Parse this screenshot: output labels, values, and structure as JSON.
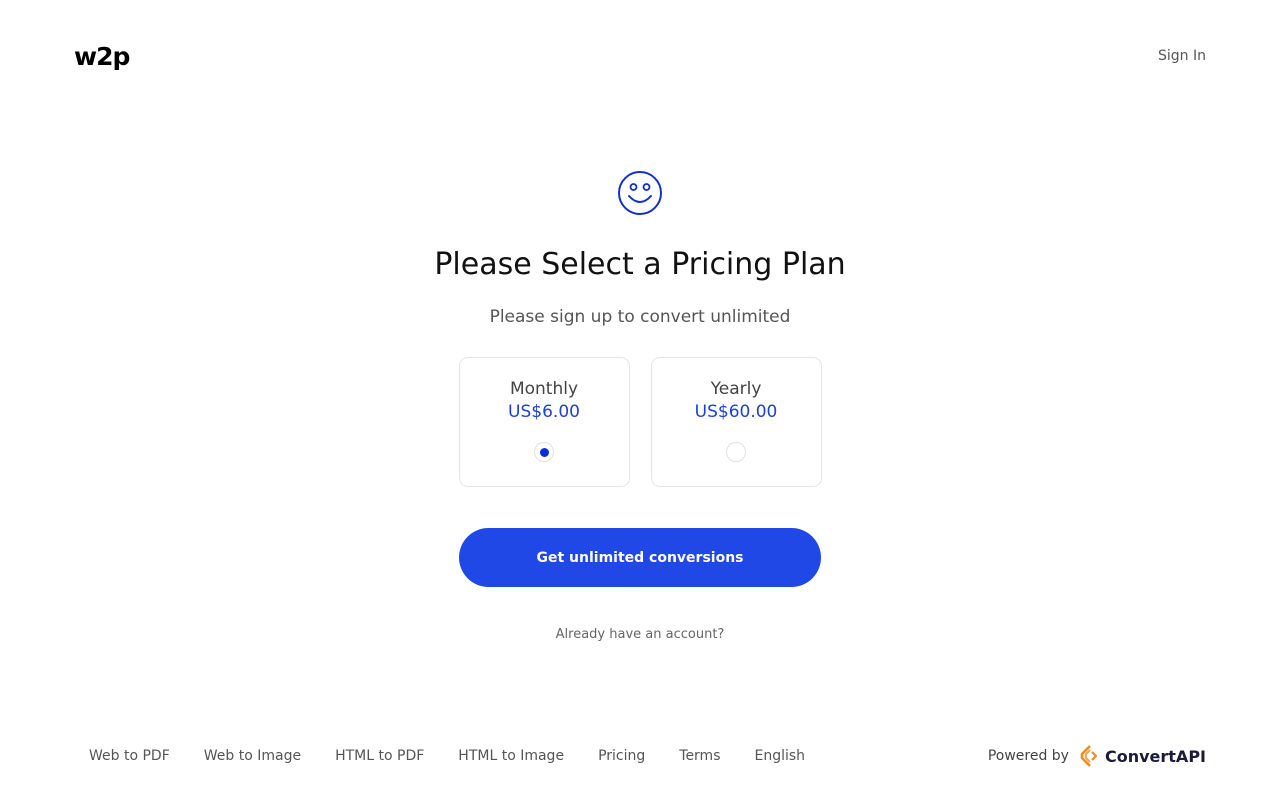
{
  "header": {
    "logo": "w2p",
    "sign_in": "Sign In"
  },
  "main": {
    "icon": "smiley-icon",
    "title": "Please Select a Pricing Plan",
    "subtitle": "Please sign up to convert unlimited",
    "plans": [
      {
        "name": "Monthly",
        "price": "US$6.00",
        "selected": true
      },
      {
        "name": "Yearly",
        "price": "US$60.00",
        "selected": false
      }
    ],
    "cta_label": "Get unlimited conversions",
    "already_account": "Already have an account?"
  },
  "footer": {
    "links": [
      "Web to PDF",
      "Web to Image",
      "HTML to PDF",
      "HTML to Image",
      "Pricing",
      "Terms",
      "English"
    ],
    "powered_by": "Powered by",
    "brand": "ConvertAPI"
  },
  "colors": {
    "accent": "#1f48e6",
    "price": "#1d3fd8",
    "brand_orange": "#f28c1e"
  }
}
